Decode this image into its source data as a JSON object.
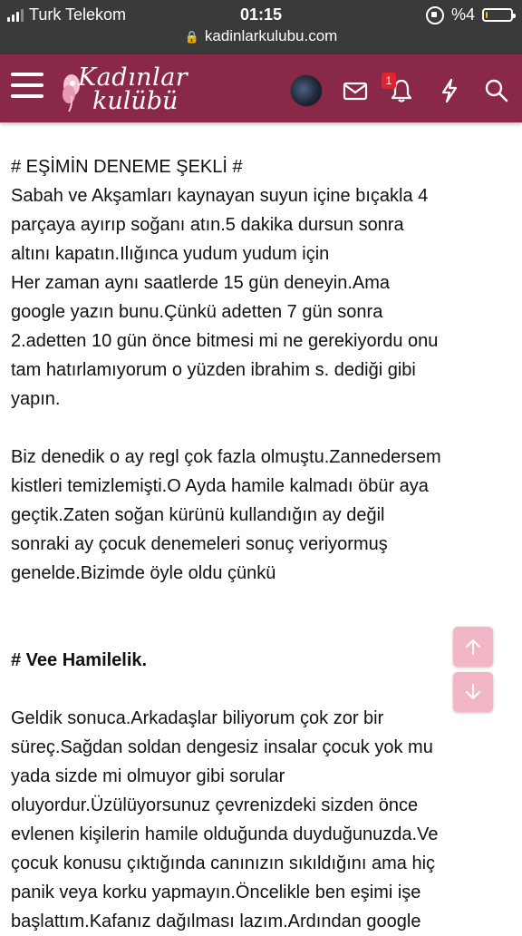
{
  "status_bar": {
    "carrier": "Turk Telekom",
    "time": "01:15",
    "battery": "%4",
    "battery_level": 0.04,
    "url": "kadinlarkulubu.com"
  },
  "navbar": {
    "logo_line1": "Kadınlar",
    "logo_line2": "kulübü",
    "notification_count": "1",
    "icons": [
      "menu-icon",
      "avatar",
      "mail-icon",
      "bell-icon",
      "lightning-icon",
      "search-icon"
    ],
    "background": "#8a2848"
  },
  "article": {
    "heading1": "# EŞİMİN DENEME ŞEKLİ #",
    "p1_lines": [
      "Sabah ve Akşamları kaynayan suyun içine bıçakla 4",
      "parçaya ayırıp soğanı atın.5 dakika dursun sonra",
      "altını kapatın.Ilığınca yudum yudum için",
      "Her zaman aynı saatlerde 15 gün deneyin.Ama",
      "google yazın bunu.Çünkü adetten 7 gün sonra",
      "2.adetten 10 gün önce bitmesi mi ne gerekiyordu onu",
      "tam hatırlamıyorum o yüzden ibrahim s. dediği gibi",
      "yapın."
    ],
    "p2_lines": [
      "Biz denedik o ay regl çok fazla olmuştu.Zannedersem",
      "kistleri temizlemişti.O Ayda hamile kalmadı öbür aya",
      "geçtik.Zaten soğan kürünü kullandığın ay değil",
      "sonraki ay çocuk denemeleri sonuç veriyormuş",
      "genelde.Bizimde öyle oldu çünkü"
    ],
    "heading2": "# Vee Hamilelik.",
    "p3_lines": [
      "Geldik sonuca.Arkadaşlar biliyorum çok zor bir",
      "süreç.Sağdan soldan dengesiz insalar çocuk yok mu",
      "yada sizde mi olmuyor gibi sorular",
      "oluyordur.Üzülüyorsunuz çevrenizdeki sizden önce",
      "evlenen kişilerin hamile olduğunda duyduğunuzda.Ve",
      "çocuk konusu çıktığında canınızın sıkıldığını ama hiç",
      "panik veya korku yapmayın.Öncelikle ben eşimi işe",
      "başlattım.Kafanız dağılması lazım.Ardından google"
    ]
  },
  "scroll": {
    "up_icon": "arrow-up-icon",
    "down_icon": "arrow-down-icon",
    "button_color": "#f2b6c6"
  }
}
